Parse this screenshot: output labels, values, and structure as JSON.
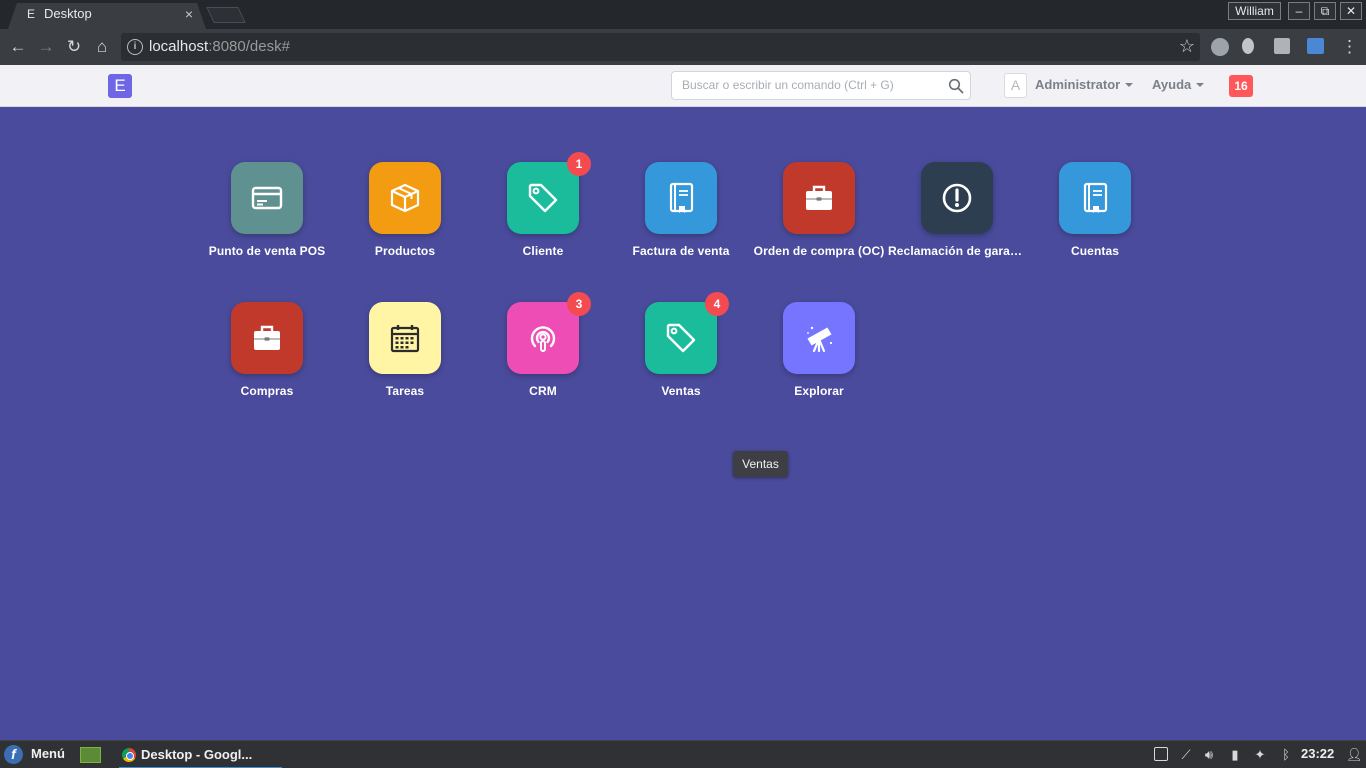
{
  "browser": {
    "tab": {
      "favicon": "E",
      "title": "Desktop",
      "close": "×"
    },
    "window": {
      "user": "William",
      "minimize": "–",
      "restore": "⧉",
      "close": "✕"
    },
    "nav": {
      "back": "←",
      "forward": "→",
      "reload": "↻",
      "home": "⌂"
    },
    "url": {
      "host": "localhost",
      "path": ":8080/desk#"
    },
    "star": "☆",
    "menu": "⋮"
  },
  "app": {
    "brand": "E",
    "search": {
      "placeholder": "Buscar o escribir un comando (Ctrl + G)"
    },
    "avatar": "A",
    "user_menu": "Administrator",
    "help_menu": "Ayuda",
    "notifications": "16"
  },
  "modules": [
    {
      "label": "Punto de venta POS",
      "color": "#5e9190",
      "icon": "credit-card-icon",
      "badge": ""
    },
    {
      "label": "Productos",
      "color": "#f39c12",
      "icon": "box-icon",
      "badge": ""
    },
    {
      "label": "Cliente",
      "color": "#1abc9c",
      "icon": "tag-icon",
      "badge": "1"
    },
    {
      "label": "Factura de venta",
      "color": "#3498db",
      "icon": "book-icon",
      "badge": ""
    },
    {
      "label": "Orden de compra (OC)",
      "color": "#c0392b",
      "icon": "briefcase-icon",
      "badge": ""
    },
    {
      "label": "Reclamación de garan...",
      "color": "#2c3e50",
      "icon": "alert-icon",
      "badge": ""
    },
    {
      "label": "Cuentas",
      "color": "#3498db",
      "icon": "book-icon",
      "badge": ""
    },
    {
      "label": "Compras",
      "color": "#c0392b",
      "icon": "briefcase-icon",
      "badge": ""
    },
    {
      "label": "Tareas",
      "color": "#fff5a5",
      "icon": "calendar-icon",
      "badge": ""
    },
    {
      "label": "CRM",
      "color": "#ef4db6",
      "icon": "podcast-icon",
      "badge": "3"
    },
    {
      "label": "Ventas",
      "color": "#1abc9c",
      "icon": "tag-icon",
      "badge": "4"
    },
    {
      "label": "Explorar",
      "color": "#7575ff",
      "icon": "telescope-icon",
      "badge": ""
    }
  ],
  "tooltip": "Ventas",
  "taskbar": {
    "menu": "Menú",
    "task": "Desktop - Googl...",
    "clock": "23:22"
  }
}
